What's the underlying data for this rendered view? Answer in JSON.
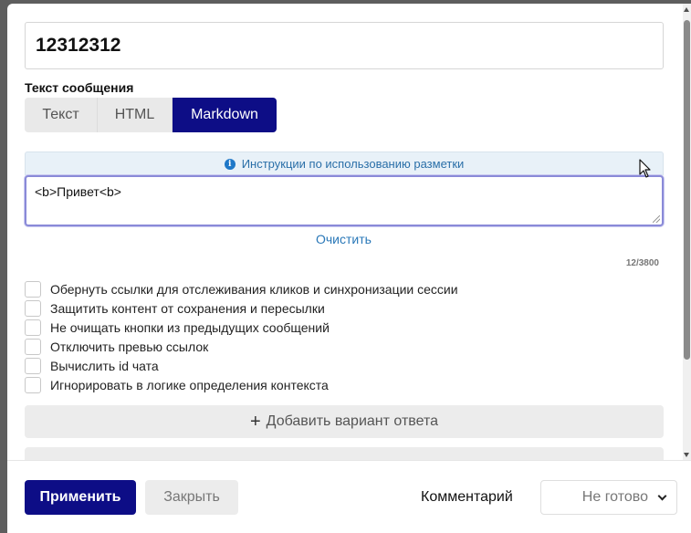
{
  "title_input": {
    "value": "12312312"
  },
  "message": {
    "label": "Текст сообщения",
    "modes": [
      {
        "label": "Текст",
        "active": false
      },
      {
        "label": "HTML",
        "active": false
      },
      {
        "label": "Markdown",
        "active": true
      }
    ],
    "hint": "Инструкции по использованию разметки",
    "hint_icon": "info-icon",
    "text": "<b>Привет<b>",
    "clear_label": "Очистить",
    "counter": "12/3800"
  },
  "options": [
    {
      "label": "Обернуть ссылки для отслеживания кликов и синхронизации сессии",
      "checked": false
    },
    {
      "label": "Защитить контент от сохранения и пересылки",
      "checked": false
    },
    {
      "label": "Не очищать кнопки из предыдущих сообщений",
      "checked": false
    },
    {
      "label": "Отключить превью ссылок",
      "checked": false
    },
    {
      "label": "Вычислить id чата",
      "checked": false
    },
    {
      "label": "Игнорировать в логике определения контекста",
      "checked": false
    }
  ],
  "add_answer": {
    "label": "Добавить вариант ответа",
    "icon": "plus-icon"
  },
  "footer": {
    "apply_label": "Применить",
    "close_label": "Закрыть",
    "comment_label": "Комментарий",
    "status_value": "Не готово"
  },
  "colors": {
    "primary": "#0d0d86",
    "link": "#2a78b8",
    "hint_bg": "#e8f1f8"
  }
}
